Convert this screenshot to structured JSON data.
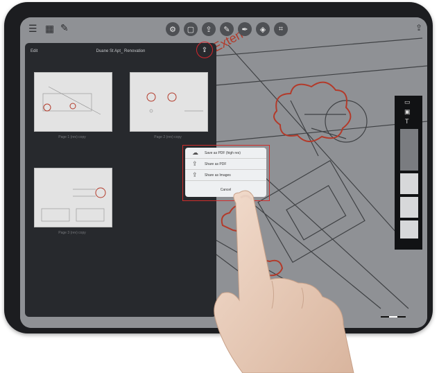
{
  "top_left_icons": [
    "menu-icon",
    "grid-icon",
    "wrench-icon"
  ],
  "center_tools": [
    "settings-icon",
    "square-icon",
    "share-icon",
    "pencil-icon",
    "pen-icon",
    "layers-icon",
    "crop-icon"
  ],
  "panel": {
    "edit_label": "Edit",
    "title": "Duane St Apt_ Renovation",
    "share_icon": "share-icon"
  },
  "pages": [
    {
      "caption": "Page 1 (rev) copy"
    },
    {
      "caption": "Page 2 (rev) copy"
    },
    {
      "caption": "Page 3 (rev) copy"
    }
  ],
  "share_menu": {
    "items": [
      {
        "icon": "cloud-icon",
        "label": "Save as PDF (high res)"
      },
      {
        "icon": "share-icon",
        "label": "Share as PDF"
      },
      {
        "icon": "share-icon",
        "label": "Share as Images"
      }
    ],
    "cancel_label": "Cancel"
  },
  "blueprint_label": "Extenc",
  "colors": {
    "accent": "#d12d2b",
    "panel": "#27292d",
    "device": "#1c1d20"
  }
}
